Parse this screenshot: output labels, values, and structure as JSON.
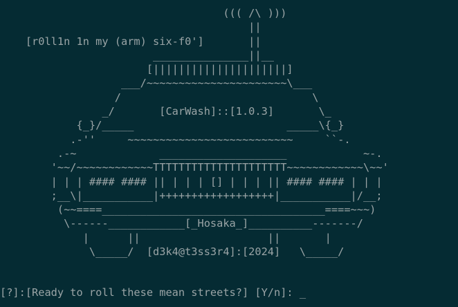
{
  "ascii_art": [
    "                                   ((( /\\ )))",
    "                                       ||",
    "    [r0ll1n 1n my (arm) six-f0']       ||",
    "                        _______________||__",
    "                       [|||||||||||||||||||||]",
    "                   ___/~~~~~~~~~~~~~~~~~~~~~~\\___",
    "                  /                              \\",
    "                _/       [CarWash]::[1.0.3]       \\_",
    "            {_}/_____                        _____\\{_}",
    "           .-''     ~~~~~~~~~~~~~~~~~~~~~~~~~~     ``-.",
    "         .-~             ____________________            ~-.",
    "        '~~/~~~~~~~~~~~~TTTTTTTTTTTTTTTTTTTTT~~~~~~~~~~~~\\~~'",
    "        | | | #### #### || | | | [] | | | || #### #### | | |",
    "        ;__\\|___________|++++++++++++++++++|___________|/__;",
    "         (~~====___________________________________====~~~)",
    "          \\------____________[_Hosaka_]__________-------/",
    "             |      ||                    ||       |",
    "              \\_____/  [d3k4@t3ss3r4]:[2024]   \\_____/"
  ],
  "prompt": {
    "text": "[?]:[Ready to roll these mean streets?] [Y/n]: ",
    "cursor": "_"
  }
}
